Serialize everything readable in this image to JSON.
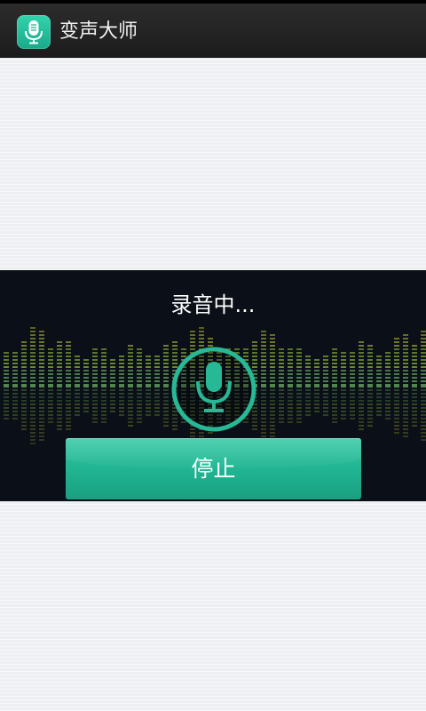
{
  "app": {
    "title": "变声大师",
    "icon": "microphone-icon",
    "accent_color": "#22b495"
  },
  "recorder": {
    "status_text": "录音中...",
    "mic_icon": "microphone-icon",
    "stop_label": "停止"
  }
}
